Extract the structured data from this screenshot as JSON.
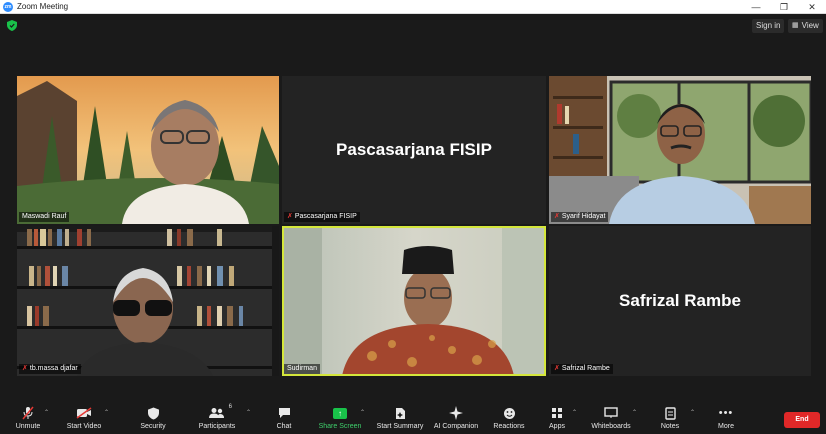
{
  "window": {
    "title": "Zoom Meeting",
    "logo": "zm"
  },
  "topbar": {
    "sign_in": "Sign in",
    "view": "View"
  },
  "tiles": [
    {
      "name": "Maswadi Rauf",
      "muted": false,
      "video": true
    },
    {
      "name": "Pascasarjana FISIP",
      "muted": true,
      "video": false,
      "display": "Pascasarjana FISIP"
    },
    {
      "name": "Syarif Hidayat",
      "muted": true,
      "video": true
    },
    {
      "name": "tb.massa djafar",
      "muted": true,
      "video": true
    },
    {
      "name": "Sudirman",
      "muted": false,
      "video": true,
      "active_speaker": true
    },
    {
      "name": "Safrizal Rambe",
      "muted": true,
      "video": false,
      "display": "Safrizal Rambe"
    }
  ],
  "toolbar": {
    "unmute": "Unmute",
    "start_video": "Start Video",
    "security": "Security",
    "participants": "Participants",
    "participants_count": "6",
    "chat": "Chat",
    "share_screen": "Share Screen",
    "start_summary": "Start Summary",
    "ai_companion": "AI Companion",
    "reactions": "Reactions",
    "apps": "Apps",
    "whiteboards": "Whiteboards",
    "notes": "Notes",
    "more": "More",
    "end": "End"
  },
  "colors": {
    "accent_green": "#19c24a",
    "end_red": "#e02828",
    "active_border": "#d4e63b"
  }
}
